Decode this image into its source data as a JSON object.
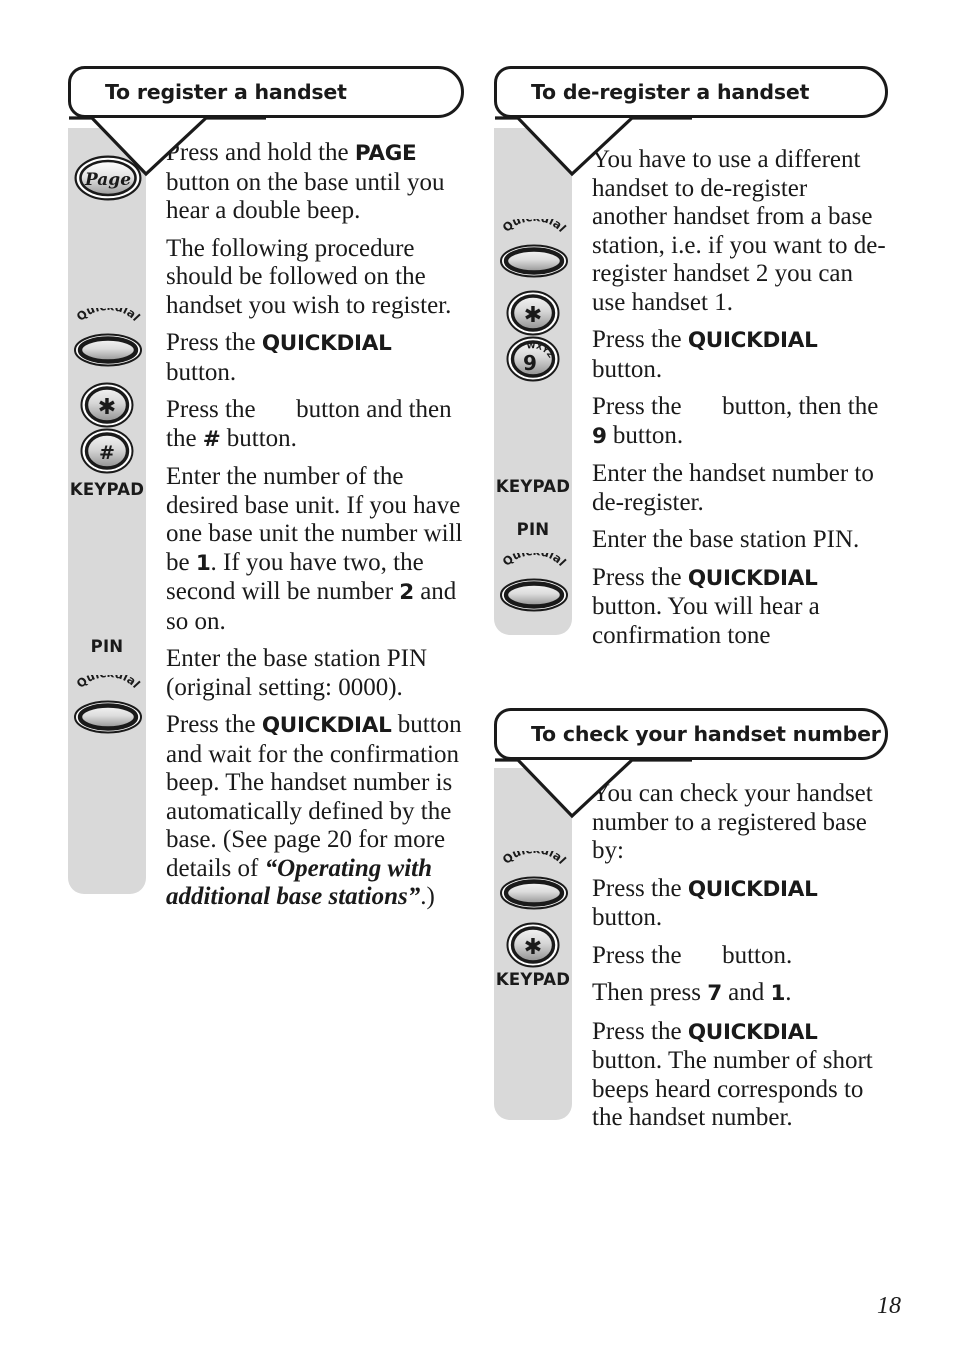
{
  "page": {
    "number": "18"
  },
  "sections": [
    {
      "id": "register",
      "title": "To register a handset",
      "gutter_labels": [
        {
          "name": "keypad",
          "text": "KEYPAD"
        },
        {
          "name": "pin",
          "text": "PIN"
        }
      ],
      "icons": [
        {
          "name": "page-button-icon",
          "label": "Page",
          "type": "oval-label"
        },
        {
          "name": "quickdial-button-icon",
          "label": "Quickdial",
          "type": "quickdial"
        },
        {
          "name": "star-key-icon",
          "label": "✳",
          "type": "round-key"
        },
        {
          "name": "hash-key-icon",
          "label": "#",
          "type": "round-key"
        },
        {
          "name": "quickdial-button-icon",
          "label": "Quickdial",
          "type": "quickdial"
        }
      ],
      "steps": [
        {
          "id": "step-page-hold",
          "parts": [
            {
              "t": "Press and hold the "
            },
            {
              "t": "PAGE",
              "s": "b"
            },
            {
              "t": " button on the base until you hear a double beep."
            }
          ]
        },
        {
          "id": "step-procedure-note",
          "parts": [
            {
              "t": "The following procedure should be followed on the handset you wish to register."
            }
          ]
        },
        {
          "id": "step-press-quickdial",
          "parts": [
            {
              "t": "Press the "
            },
            {
              "t": "QUICKDIAL",
              "s": "b"
            },
            {
              "t": " button."
            }
          ]
        },
        {
          "id": "step-press-star-hash",
          "parts": [
            {
              "t": "Press the "
            },
            {
              "t": "",
              "s": "gap"
            },
            {
              "t": " button and then the "
            },
            {
              "t": "#",
              "s": "b"
            },
            {
              "t": " button."
            }
          ]
        },
        {
          "id": "step-enter-base-number",
          "parts": [
            {
              "t": "Enter the number of the desired base unit. If you have one base unit the number will be "
            },
            {
              "t": "1",
              "s": "b"
            },
            {
              "t": ". If you have two, the second will be number "
            },
            {
              "t": "2",
              "s": "b"
            },
            {
              "t": " and so on."
            }
          ]
        },
        {
          "id": "step-enter-pin",
          "parts": [
            {
              "t": "Enter the base station PIN (original setting: 0000)."
            }
          ]
        },
        {
          "id": "step-confirm-quickdial",
          "parts": [
            {
              "t": "Press the "
            },
            {
              "t": "QUICKDIAL",
              "s": "b"
            },
            {
              "t": " button and wait for the confirmation beep. The handset number is automatically defined by the base. (See page 20 for more details of "
            },
            {
              "t": "“Operating with additional base stations”",
              "s": "i"
            },
            {
              "t": ".)"
            }
          ]
        }
      ]
    },
    {
      "id": "deregister",
      "title": "To de-register a handset",
      "gutter_labels": [
        {
          "name": "keypad",
          "text": "KEYPAD"
        },
        {
          "name": "pin",
          "text": "PIN"
        }
      ],
      "icons": [
        {
          "name": "quickdial-button-icon",
          "label": "Quickdial",
          "type": "quickdial"
        },
        {
          "name": "star-key-icon",
          "label": "✳",
          "type": "round-key"
        },
        {
          "name": "nine-key-icon",
          "label": "9",
          "sub": "WXYZ",
          "type": "round-key"
        },
        {
          "name": "quickdial-button-icon",
          "label": "Quickdial",
          "type": "quickdial"
        }
      ],
      "steps": [
        {
          "id": "step-use-different-handset",
          "parts": [
            {
              "t": "You have to use a different handset to de-register another handset from a base station, i.e. if you want to de-register handset 2 you can use handset 1."
            }
          ]
        },
        {
          "id": "step-press-quickdial",
          "parts": [
            {
              "t": "Press the "
            },
            {
              "t": "QUICKDIAL",
              "s": "b"
            },
            {
              "t": " button."
            }
          ]
        },
        {
          "id": "step-press-star-nine",
          "parts": [
            {
              "t": "Press the "
            },
            {
              "t": "",
              "s": "gap"
            },
            {
              "t": " button, then the "
            },
            {
              "t": "9",
              "s": "b"
            },
            {
              "t": " button."
            }
          ]
        },
        {
          "id": "step-enter-handset-number",
          "parts": [
            {
              "t": "Enter the handset number to de-register."
            }
          ]
        },
        {
          "id": "step-enter-pin",
          "parts": [
            {
              "t": "Enter the base station PIN."
            }
          ]
        },
        {
          "id": "step-confirm-quickdial",
          "parts": [
            {
              "t": "Press the "
            },
            {
              "t": "QUICKDIAL",
              "s": "b"
            },
            {
              "t": " button. You will hear a confirmation tone"
            }
          ]
        }
      ]
    },
    {
      "id": "check-number",
      "title": "To check your handset number",
      "gutter_labels": [
        {
          "name": "keypad",
          "text": "KEYPAD"
        }
      ],
      "icons": [
        {
          "name": "quickdial-button-icon",
          "label": "Quickdial",
          "type": "quickdial"
        },
        {
          "name": "star-key-icon",
          "label": "✳",
          "type": "round-key"
        }
      ],
      "steps": [
        {
          "id": "step-intro",
          "parts": [
            {
              "t": "You can check your handset number to a registered base by:"
            }
          ]
        },
        {
          "id": "step-press-quickdial",
          "parts": [
            {
              "t": "Press the "
            },
            {
              "t": "QUICKDIAL",
              "s": "b"
            },
            {
              "t": " button."
            }
          ]
        },
        {
          "id": "step-press-star",
          "parts": [
            {
              "t": "Press the "
            },
            {
              "t": "",
              "s": "gap"
            },
            {
              "t": " button."
            }
          ]
        },
        {
          "id": "step-press-7-1",
          "parts": [
            {
              "t": "Then press "
            },
            {
              "t": "7",
              "s": "b"
            },
            {
              "t": " and "
            },
            {
              "t": "1",
              "s": "b"
            },
            {
              "t": "."
            }
          ]
        },
        {
          "id": "step-final-quickdial",
          "parts": [
            {
              "t": "Press the "
            },
            {
              "t": "QUICKDIAL",
              "s": "b"
            },
            {
              "t": " button. The number of short beeps heard corresponds to the handset number."
            }
          ]
        }
      ]
    }
  ],
  "colors": {
    "panel_grey": "#d9d9d9",
    "ink": "#1a1a1a",
    "paper": "#ffffff"
  }
}
